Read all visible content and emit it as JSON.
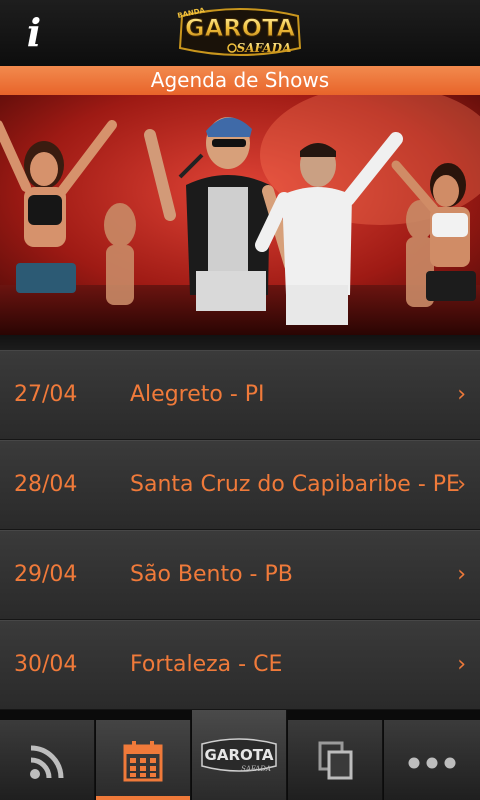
{
  "header": {
    "info_icon": "info-icon",
    "info_glyph": "i",
    "logo": {
      "small": "BANDA",
      "main": "GAROTA",
      "sub": "SAFADA"
    }
  },
  "section": {
    "title": "Agenda de Shows"
  },
  "shows": [
    {
      "date": "27/04",
      "city": "Alegreto - PI"
    },
    {
      "date": "28/04",
      "city": "Santa Cruz do Capibaribe - PE"
    },
    {
      "date": "29/04",
      "city": "São Bento - PB"
    },
    {
      "date": "30/04",
      "city": "Fortaleza - CE"
    }
  ],
  "chevron": "›",
  "tabs": [
    {
      "icon": "rss-icon"
    },
    {
      "icon": "calendar-icon",
      "selected": true
    },
    {
      "icon": "garota-logo-icon",
      "label": "GAROTA"
    },
    {
      "icon": "copy-icon"
    },
    {
      "icon": "more-icon",
      "label": "•••"
    }
  ],
  "colors": {
    "accent": "#f07a3a",
    "header_orange": "#ec6c33",
    "background": "#2b2b2b"
  }
}
